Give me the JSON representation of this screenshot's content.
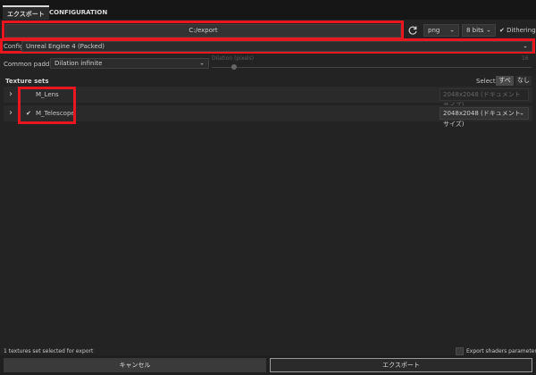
{
  "tabs": [
    {
      "label": "エクスポート",
      "active": true
    },
    {
      "label": "CONFIGURATION",
      "active": false
    }
  ],
  "export_path": "C:/export",
  "format": "png",
  "bit_depth": "8 bits",
  "dithering": {
    "label": "Dithering",
    "checked": true
  },
  "config": {
    "label": "Config",
    "value": "Unreal Engine 4 (Packed)"
  },
  "padding": {
    "label": "Common padding",
    "value": "Dilation infinite"
  },
  "dilation": {
    "label": "Dilation (pixels)",
    "value": "16"
  },
  "texture_sets": {
    "header": "Texture sets",
    "select_label": "Select",
    "all_label": "すべて",
    "none_label": "なし",
    "items": [
      {
        "name": "M_Lens",
        "checked": false,
        "size": "2048x2048 (ドキュメント サイズ)",
        "size_enabled": false
      },
      {
        "name": "M_Telescope",
        "checked": true,
        "size": "2048x2048 (ドキュメント サイズ)",
        "size_enabled": true
      }
    ]
  },
  "footer": {
    "status": "1 textures set selected for export",
    "shaders_label": "Export shaders parameters",
    "cancel_label": "キャンセル",
    "export_label": "エクスポート"
  },
  "colors": {
    "highlight": "#e8161e",
    "background": "#1f1f1f"
  }
}
